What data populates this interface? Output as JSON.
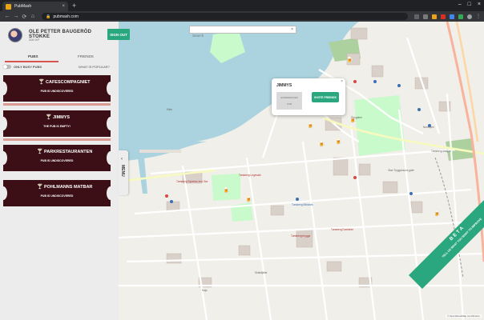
{
  "browser": {
    "tab_title": "PubMash",
    "tab_close": "×",
    "new_tab": "+",
    "url": "pubmash.com",
    "win_min": "–",
    "win_max": "□",
    "win_close": "×",
    "back": "←",
    "forward": "→",
    "reload": "⟳",
    "home": "⌂",
    "lock": "🔒"
  },
  "profile": {
    "name": "OLE PETTER BAUGERÖD STOKKE",
    "sub": "200 XP",
    "signout_label": "SIGN OUT"
  },
  "tabs": {
    "pubs": "PUBS",
    "friends": "FRIENDS"
  },
  "filters": {
    "busy_label": "ONLY BUSY PUBS",
    "right_label": "WHAT IS POPULAR?"
  },
  "pubs": [
    {
      "name": "CAFESCOMPAGNIET",
      "status": "PUB IS UNDISCOVERED"
    },
    {
      "name": "JIMMYS",
      "status": "THE PUB IS EMPTY!"
    },
    {
      "name": "PARKRESTAURANTEN",
      "status": "PUB IS UNDISCOVERED"
    },
    {
      "name": "POHLMANNS MATBAR",
      "status": "PUB IS UNDISCOVERED"
    }
  ],
  "handle": {
    "label": "MENU",
    "chevron": "‹"
  },
  "search": {
    "placeholder": "Search",
    "clear": "×"
  },
  "popup": {
    "title": "JIMMYS",
    "close": "×",
    "box_line1": "EXPERIENCED",
    "box_line2": "PUB",
    "invite_label": "INVITE FRIENDS"
  },
  "beta": {
    "title": "BETA",
    "subtitle": "TELL US WHAT YOU WANT TO IMPROVE"
  },
  "attribution": "© OpenStreetMap contributors",
  "map_labels": {
    "l1": "Tønsberg Sykehus Innl. Bor",
    "l2": "Tønsberg Legevakt",
    "l3": "Tønsberg Bibliotek",
    "l4": "Tønsberg Domkirke",
    "l5": "Slottsfjellet",
    "l6": "Kilen",
    "l7": "Kaja",
    "l8": "Olav Tryggvesons gate",
    "l9": "Storgaten",
    "l10": "Tønsberg brygge",
    "l11": "Tønsberg stasjon",
    "l12": "Nordbyen"
  },
  "colors": {
    "accent": "#2aa77e",
    "card": "#3b0f15",
    "water": "#aad3df",
    "park": "#c8facc"
  }
}
